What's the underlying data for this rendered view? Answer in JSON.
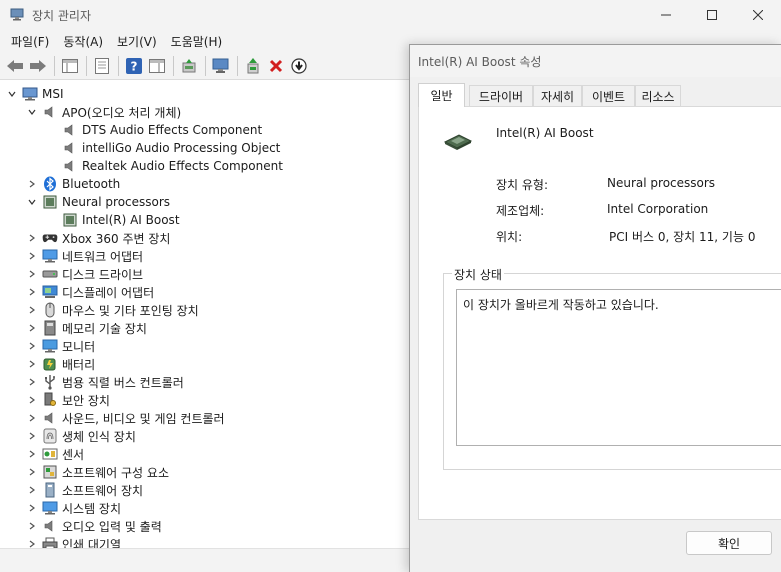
{
  "window": {
    "title": "장치 관리자",
    "controls": {
      "minimize": "minimize-icon",
      "maximize": "maximize-icon",
      "close": "close-icon"
    }
  },
  "menu": [
    "파일(F)",
    "동작(A)",
    "보기(V)",
    "도움말(H)"
  ],
  "toolbar": [
    "back-arrow-icon",
    "forward-arrow-icon",
    "show-hide-console-tree-icon",
    "properties-icon",
    "help-icon",
    "action-pane-icon",
    "update-driver-icon",
    "scan-hardware-icon",
    "enable-device-icon",
    "uninstall-device-icon",
    "disable-device-icon"
  ],
  "tree": {
    "root": "MSI",
    "items": [
      {
        "label": "APO(오디오 처리 개체)",
        "level": 1,
        "expanded": true,
        "icon": "speaker-icon"
      },
      {
        "label": "DTS Audio Effects Component",
        "level": 2,
        "icon": "speaker-icon"
      },
      {
        "label": "intelliGo Audio Processing Object",
        "level": 2,
        "icon": "speaker-icon"
      },
      {
        "label": "Realtek Audio Effects Component",
        "level": 2,
        "icon": "speaker-icon"
      },
      {
        "label": "Bluetooth",
        "level": 1,
        "expanded": false,
        "icon": "bluetooth-icon"
      },
      {
        "label": "Neural processors",
        "level": 1,
        "expanded": true,
        "icon": "chip-icon"
      },
      {
        "label": "Intel(R) AI Boost",
        "level": 2,
        "icon": "chip-icon"
      },
      {
        "label": "Xbox 360 주변 장치",
        "level": 1,
        "expanded": false,
        "icon": "gamepad-icon"
      },
      {
        "label": "네트워크 어댑터",
        "level": 1,
        "expanded": false,
        "icon": "network-icon"
      },
      {
        "label": "디스크 드라이브",
        "level": 1,
        "expanded": false,
        "icon": "disk-icon"
      },
      {
        "label": "디스플레이 어댑터",
        "level": 1,
        "expanded": false,
        "icon": "display-adapter-icon"
      },
      {
        "label": "마우스 및 기타 포인팅 장치",
        "level": 1,
        "expanded": false,
        "icon": "mouse-icon"
      },
      {
        "label": "메모리 기술 장치",
        "level": 1,
        "expanded": false,
        "icon": "memory-icon"
      },
      {
        "label": "모니터",
        "level": 1,
        "expanded": false,
        "icon": "monitor-icon"
      },
      {
        "label": "배터리",
        "level": 1,
        "expanded": false,
        "icon": "battery-icon"
      },
      {
        "label": "범용 직렬 버스 컨트롤러",
        "level": 1,
        "expanded": false,
        "icon": "usb-icon"
      },
      {
        "label": "보안 장치",
        "level": 1,
        "expanded": false,
        "icon": "security-icon"
      },
      {
        "label": "사운드, 비디오 및 게임 컨트롤러",
        "level": 1,
        "expanded": false,
        "icon": "speaker-icon"
      },
      {
        "label": "생체 인식 장치",
        "level": 1,
        "expanded": false,
        "icon": "fingerprint-icon"
      },
      {
        "label": "센서",
        "level": 1,
        "expanded": false,
        "icon": "sensor-icon"
      },
      {
        "label": "소프트웨어 구성 요소",
        "level": 1,
        "expanded": false,
        "icon": "software-component-icon"
      },
      {
        "label": "소프트웨어 장치",
        "level": 1,
        "expanded": false,
        "icon": "software-device-icon"
      },
      {
        "label": "시스템 장치",
        "level": 1,
        "expanded": false,
        "icon": "system-icon"
      },
      {
        "label": "오디오 입력 및 출력",
        "level": 1,
        "expanded": false,
        "icon": "speaker-icon"
      },
      {
        "label": "인쇄 대기열",
        "level": 1,
        "expanded": false,
        "icon": "printer-icon"
      }
    ]
  },
  "dialog": {
    "title": "Intel(R) AI Boost 속성",
    "tabs": [
      "일반",
      "드라이버",
      "자세히",
      "이벤트",
      "리소스"
    ],
    "active_tab": "일반",
    "device_name": "Intel(R) AI Boost",
    "properties": [
      {
        "label": "장치 유형:",
        "value": "Neural processors"
      },
      {
        "label": "제조업체:",
        "value": "Intel Corporation"
      },
      {
        "label": "위치:",
        "value": "PCI 버스 0, 장치 11, 기능 0"
      }
    ],
    "status_group": "장치 상태",
    "status_text": "이 장치가 올바르게 작동하고 있습니다.",
    "ok_label": "확인"
  }
}
